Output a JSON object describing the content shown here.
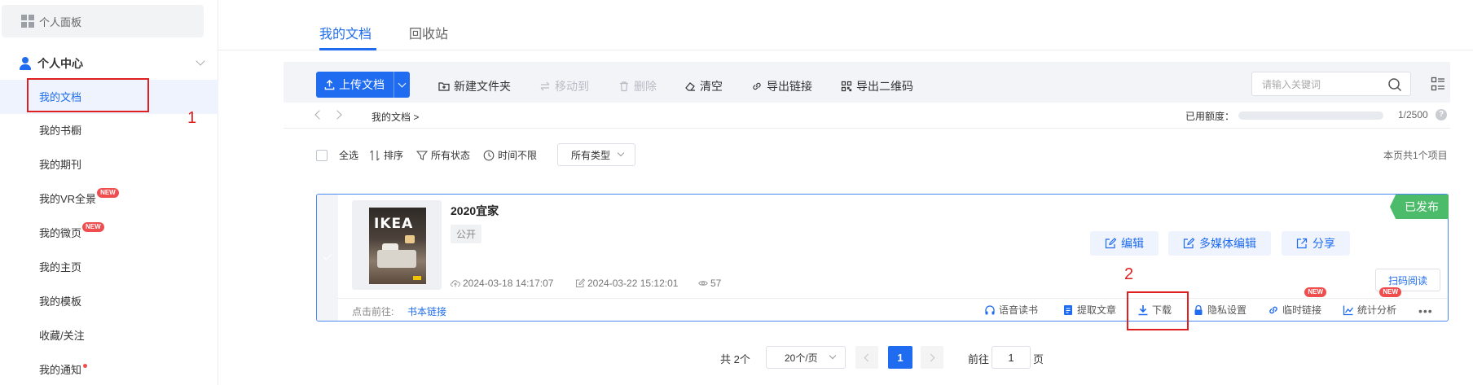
{
  "sidebar": {
    "dashboard_label": "个人面板",
    "center_label": "个人中心",
    "items": [
      {
        "label": "我的文档"
      },
      {
        "label": "我的书橱"
      },
      {
        "label": "我的期刊"
      },
      {
        "label": "我的VR全景",
        "badge": "NEW"
      },
      {
        "label": "我的微页",
        "badge": "NEW"
      },
      {
        "label": "我的主页"
      },
      {
        "label": "我的模板"
      },
      {
        "label": "收藏/关注"
      },
      {
        "label": "我的通知"
      }
    ]
  },
  "annotations": {
    "one": "1",
    "two": "2"
  },
  "tabs": [
    {
      "label": "我的文档"
    },
    {
      "label": "回收站"
    }
  ],
  "toolbar": {
    "upload_label": "上传文档",
    "new_folder": "新建文件夹",
    "move_to": "移动到",
    "delete": "删除",
    "clear": "清空",
    "export_link": "导出链接",
    "export_qr": "导出二维码",
    "search_placeholder": "请输入关键词"
  },
  "breadcrumb": {
    "current": "我的文档"
  },
  "quota": {
    "label": "已用额度：",
    "value": "1/2500",
    "used_fraction": 0.0004
  },
  "filters": {
    "select_all": "全选",
    "sort": "排序",
    "status": "所有状态",
    "time": "时间不限",
    "type": "所有类型",
    "count_text": "本页共1个项目"
  },
  "document": {
    "title": "2020宜家",
    "tag": "公开",
    "cover_text": "IKEA",
    "created": "2024-03-18 14:17:07",
    "modified": "2024-03-22 15:12:01",
    "views": "57",
    "status": "已发布",
    "actions": {
      "edit": "编辑",
      "multimedia": "多媒体编辑",
      "share": "分享",
      "scan": "扫码阅读"
    },
    "goto_label": "点击前往:",
    "goto_link": "书本链接",
    "footer": {
      "audio": "语音读书",
      "extract": "提取文章",
      "download": "下载",
      "privacy": "隐私设置",
      "temp_link": "临时链接",
      "stats": "统计分析",
      "badge": "NEW"
    }
  },
  "pagination": {
    "total": "共 2个",
    "page_size": "20个/页",
    "current": "1",
    "goto_prefix": "前往",
    "goto_value": "1",
    "goto_suffix": "页"
  },
  "colors": {
    "accent": "#1f6cf0",
    "published": "#4cbb6a",
    "annotation": "#e02020",
    "badge": "#f04e4e"
  }
}
